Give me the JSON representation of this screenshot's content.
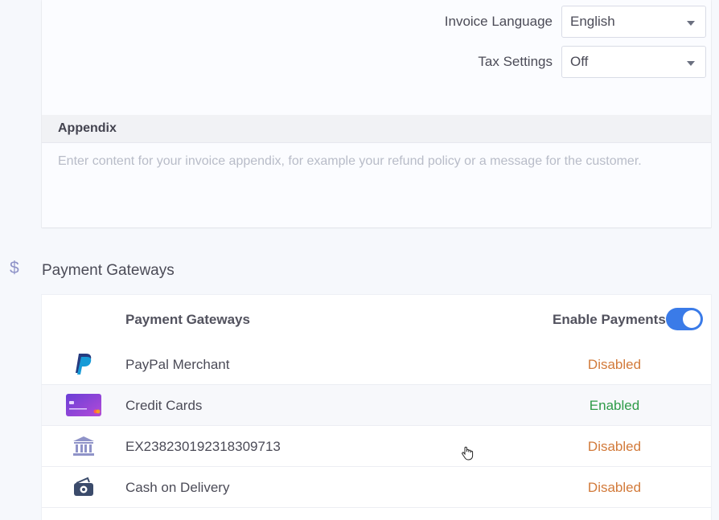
{
  "settings": {
    "invoice_language": {
      "label": "Invoice Language",
      "value": "English"
    },
    "tax_settings": {
      "label": "Tax Settings",
      "value": "Off"
    }
  },
  "appendix": {
    "title": "Appendix",
    "placeholder": "Enter content for your invoice appendix, for example your refund policy or a message for the customer."
  },
  "payment_section": {
    "icon": "dollar-icon",
    "title": "Payment Gateways"
  },
  "gateways": {
    "column_title": "Payment Gateways",
    "enable_label": "Enable Payments",
    "enable_state": true,
    "rows": [
      {
        "icon": "paypal-icon",
        "name": "PayPal Merchant",
        "status": "Disabled"
      },
      {
        "icon": "credit-card-icon",
        "name": "Credit Cards",
        "status": "Enabled"
      },
      {
        "icon": "bank-icon",
        "name": "EX238230192318309713",
        "status": "Disabled"
      },
      {
        "icon": "cash-icon",
        "name": "Cash on Delivery",
        "status": "Disabled"
      }
    ]
  },
  "colors": {
    "accent": "#3a7be8",
    "enabled": "#2e9b47",
    "disabled": "#d27a3a",
    "bank_icon": "#8f93c8"
  }
}
